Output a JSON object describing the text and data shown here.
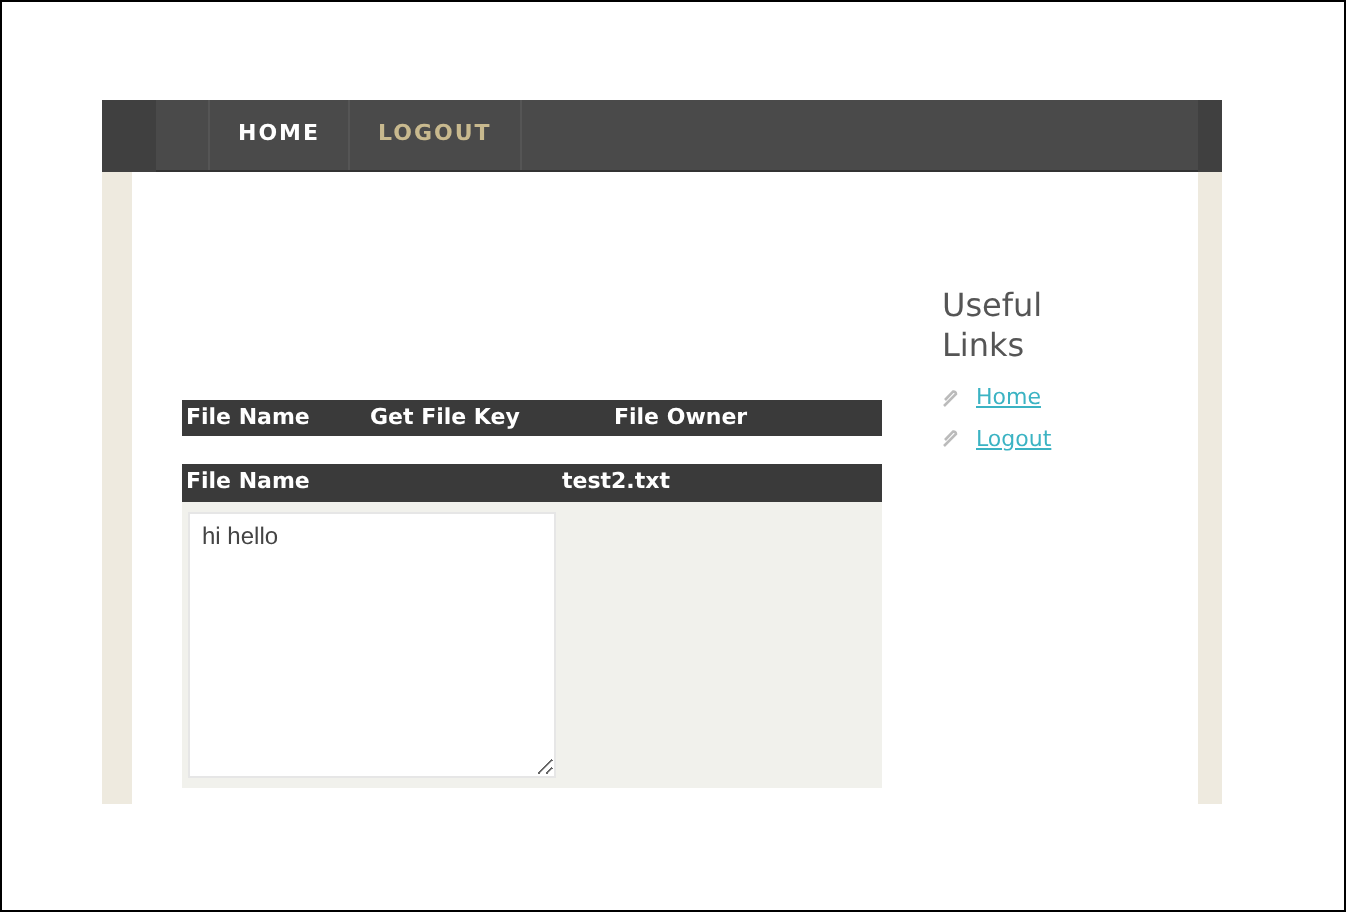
{
  "nav": [
    {
      "label": "HOME",
      "selected": true
    },
    {
      "label": "LOGOUT",
      "selected": false
    }
  ],
  "files_table": {
    "columns": [
      "File Name",
      "Get File Key",
      "File Owner"
    ]
  },
  "file_view": {
    "header": [
      "File Name",
      "test2.txt"
    ],
    "content": "hi hello"
  },
  "sidebar": {
    "title": "Useful Links",
    "links": [
      "Home",
      "Logout"
    ]
  }
}
